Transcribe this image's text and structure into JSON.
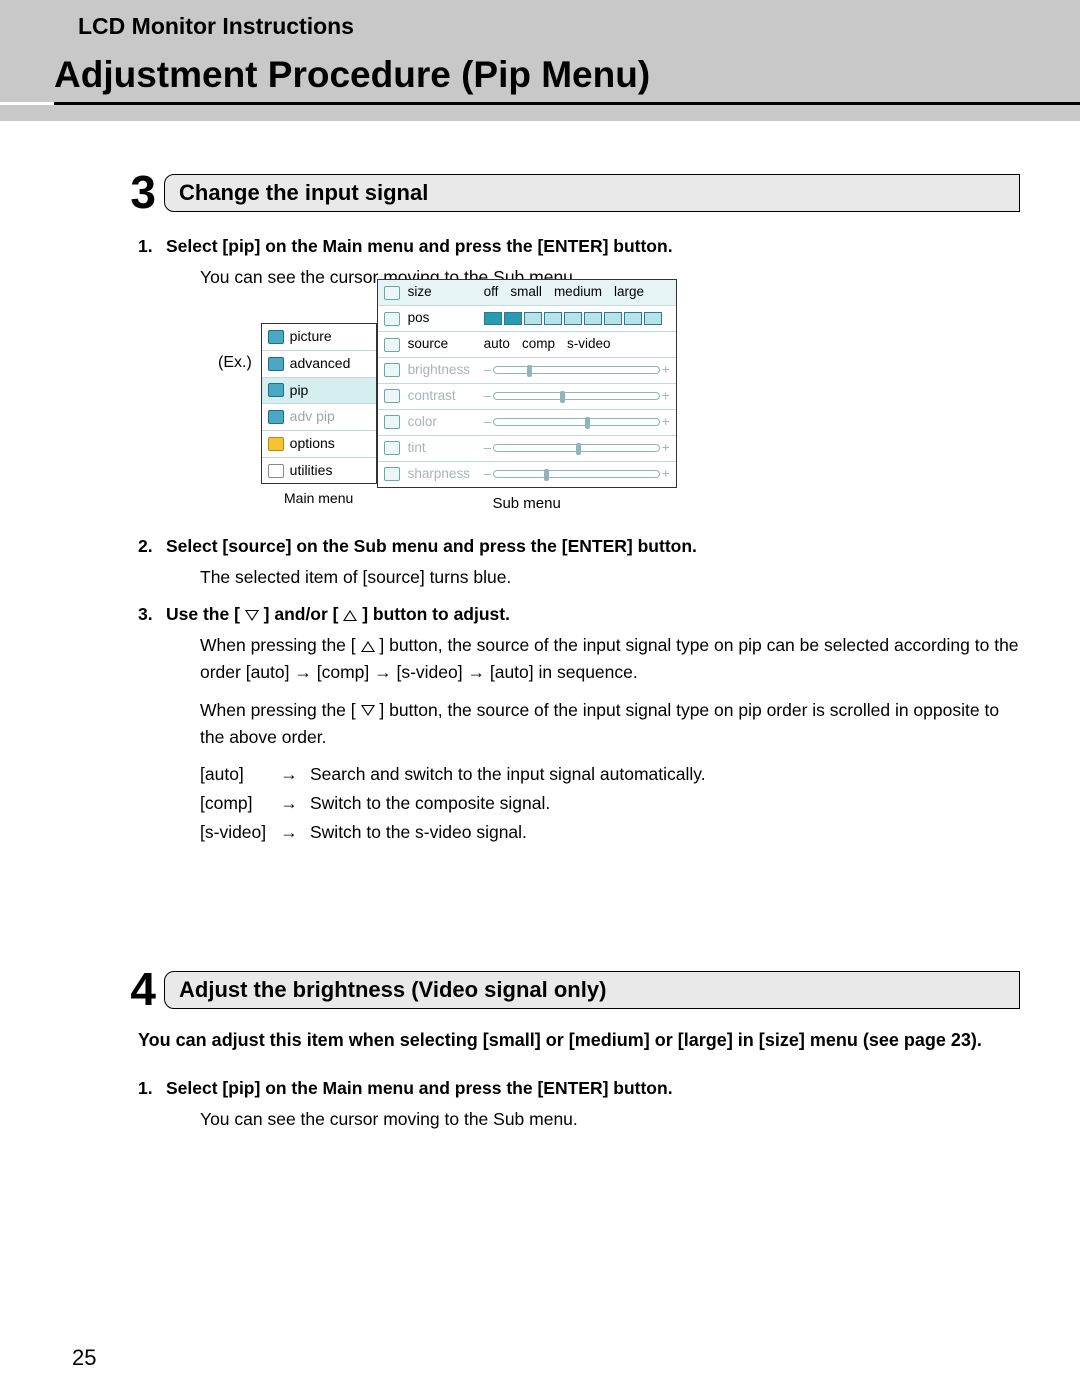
{
  "header": {
    "crumb": "LCD Monitor Instructions",
    "title": "Adjustment Procedure (Pip Menu)"
  },
  "page_number": "25",
  "step3": {
    "num": "3",
    "title": "Change the input signal",
    "items": [
      {
        "n": "1.",
        "title_a": "Select [",
        "title_b": "pip",
        "title_c": "] on the Main menu and press the [ENTER] button.",
        "note": "You can see the cursor moving to the Sub menu."
      },
      {
        "n": "2.",
        "title_a": "Select [",
        "title_b": "source",
        "title_c": "] on the Sub menu and press the [ENTER] button.",
        "note_a": "The selected item of [",
        "note_b": "source",
        "note_c": "] turns blue."
      },
      {
        "n": "3.",
        "title": "Use the [ ▽ ] and/or [ △ ] button to adjust.",
        "body1_a": "When pressing the [ △ ] button, the source of the input signal type on pip can be selected according to the order [",
        "body1_b": "auto",
        "body1_c": "] → [",
        "body1_d": "comp",
        "body1_e": "] → [",
        "body1_f": "s-video",
        "body1_g": "] → [",
        "body1_h": "auto",
        "body1_i": "] in sequence.",
        "body2": "When pressing the [ ▽ ] button, the source of the input signal type on pip order is scrolled in opposite to the above order.",
        "tbl": [
          {
            "k": "[auto]",
            "a": "→",
            "d": "Search and switch to the input signal automatically."
          },
          {
            "k": "[comp]",
            "a": "→",
            "d": "Switch to the composite signal."
          },
          {
            "k": "[s-video]",
            "a": "→",
            "d": "Switch to the s-video signal."
          }
        ]
      }
    ],
    "osd": {
      "ex": "(Ex.)",
      "main_label": "Main menu",
      "sub_label": "Sub menu",
      "main": [
        "picture",
        "advanced",
        "pip",
        "adv pip",
        "options",
        "utilities"
      ],
      "sub": {
        "size": {
          "label": "size",
          "opts": [
            "off",
            "small",
            "medium",
            "large"
          ]
        },
        "pos": {
          "label": "pos"
        },
        "source": {
          "label": "source",
          "opts": [
            "auto",
            "comp",
            "s-video"
          ]
        },
        "brightness": {
          "label": "brightness"
        },
        "contrast": {
          "label": "contrast"
        },
        "color": {
          "label": "color"
        },
        "tint": {
          "label": "tint"
        },
        "sharpness": {
          "label": "sharpness"
        }
      }
    }
  },
  "step4": {
    "num": "4",
    "title": "Adjust the brightness (Video signal only)",
    "lead_a": "You can adjust this item when selecting [",
    "lead_b": "small",
    "lead_c": "] or [",
    "lead_d": "medium",
    "lead_e": "] or [",
    "lead_f": "large",
    "lead_g": "] in [",
    "lead_h": "size",
    "lead_i": "] menu (see page 23).",
    "items": [
      {
        "n": "1.",
        "title_a": "Select [",
        "title_b": "pip",
        "title_c": "] on the Main menu and press the [ENTER] button.",
        "note": "You can see the cursor moving to the Sub menu."
      }
    ]
  }
}
